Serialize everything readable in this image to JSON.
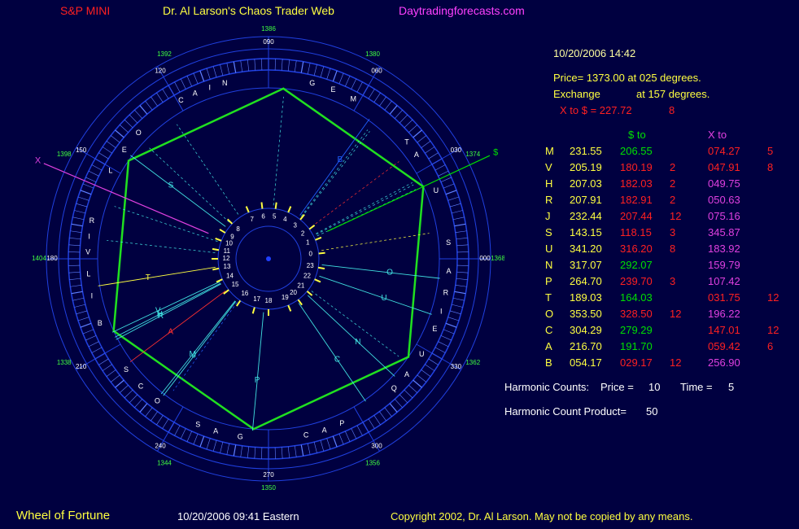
{
  "header": {
    "instrument": "S&P MINI",
    "title": "Dr. Al Larson's Chaos Trader Web",
    "site": "Daytradingforecasts.com"
  },
  "info": {
    "datetime": "10/20/2006 14:42",
    "price_line": "Price= 1373.00 at 025 degrees.",
    "exchange_label": "Exchange",
    "exchange_value": "at 157 degrees.",
    "xto_line": "X to $  = 227.72",
    "xto_count": "8"
  },
  "table": {
    "headers": {
      "dollar_to": "$ to",
      "x_to": "X to"
    },
    "rows": [
      {
        "sym": "M",
        "pos": "231.55",
        "d": "206.55",
        "dc": "",
        "x": "074.27",
        "xc": "5",
        "dcolor": "#00e000",
        "xcolor": "#ff2020"
      },
      {
        "sym": "V",
        "pos": "205.19",
        "d": "180.19",
        "dc": "2",
        "x": "047.91",
        "xc": "8",
        "dcolor": "#ff2020",
        "xcolor": "#ff2020"
      },
      {
        "sym": "H",
        "pos": "207.03",
        "d": "182.03",
        "dc": "2",
        "x": "049.75",
        "xc": "",
        "dcolor": "#ff2020",
        "xcolor": "#e040e0"
      },
      {
        "sym": "R",
        "pos": "207.91",
        "d": "182.91",
        "dc": "2",
        "x": "050.63",
        "xc": "",
        "dcolor": "#ff2020",
        "xcolor": "#e040e0"
      },
      {
        "sym": "J",
        "pos": "232.44",
        "d": "207.44",
        "dc": "12",
        "x": "075.16",
        "xc": "",
        "dcolor": "#ff2020",
        "xcolor": "#e040e0"
      },
      {
        "sym": "S",
        "pos": "143.15",
        "d": "118.15",
        "dc": "3",
        "x": "345.87",
        "xc": "",
        "dcolor": "#ff2020",
        "xcolor": "#e040e0"
      },
      {
        "sym": "U",
        "pos": "341.20",
        "d": "316.20",
        "dc": "8",
        "x": "183.92",
        "xc": "",
        "dcolor": "#ff2020",
        "xcolor": "#e040e0"
      },
      {
        "sym": "N",
        "pos": "317.07",
        "d": "292.07",
        "dc": "",
        "x": "159.79",
        "xc": "",
        "dcolor": "#00e000",
        "xcolor": "#e040e0"
      },
      {
        "sym": "P",
        "pos": "264.70",
        "d": "239.70",
        "dc": "3",
        "x": "107.42",
        "xc": "",
        "dcolor": "#ff2020",
        "xcolor": "#e040e0"
      },
      {
        "sym": "T",
        "pos": "189.03",
        "d": "164.03",
        "dc": "",
        "x": "031.75",
        "xc": "12",
        "dcolor": "#00e000",
        "xcolor": "#ff2020"
      },
      {
        "sym": "O",
        "pos": "353.50",
        "d": "328.50",
        "dc": "12",
        "x": "196.22",
        "xc": "",
        "dcolor": "#ff2020",
        "xcolor": "#e040e0"
      },
      {
        "sym": "C",
        "pos": "304.29",
        "d": "279.29",
        "dc": "",
        "x": "147.01",
        "xc": "12",
        "dcolor": "#00e000",
        "xcolor": "#ff2020"
      },
      {
        "sym": "A",
        "pos": "216.70",
        "d": "191.70",
        "dc": "",
        "x": "059.42",
        "xc": "6",
        "dcolor": "#00e000",
        "xcolor": "#ff2020"
      },
      {
        "sym": "B",
        "pos": "054.17",
        "d": "029.17",
        "dc": "12",
        "x": "256.90",
        "xc": "",
        "dcolor": "#ff2020",
        "xcolor": "#e040e0"
      }
    ]
  },
  "harmonics": {
    "label": "Harmonic Counts:",
    "price_label": "Price =",
    "price_value": "10",
    "time_label": "Time =",
    "time_value": "5",
    "product_label": "Harmonic Count Product=",
    "product_value": "50"
  },
  "footer": {
    "app_name": "Wheel of Fortune",
    "timestamp": "10/20/2006 09:41 Eastern",
    "copyright": "Copyright 2002, Dr. Al Larson. May not be copied by any means."
  },
  "wheel": {
    "degree_labels": [
      {
        "text": "000",
        "deg": 0
      },
      {
        "text": "030",
        "deg": 30
      },
      {
        "text": "060",
        "deg": 60
      },
      {
        "text": "090",
        "deg": 90
      },
      {
        "text": "120",
        "deg": 120
      },
      {
        "text": "150",
        "deg": 150
      },
      {
        "text": "180",
        "deg": 180
      },
      {
        "text": "210",
        "deg": 210
      },
      {
        "text": "240",
        "deg": 240
      },
      {
        "text": "270",
        "deg": 270
      },
      {
        "text": "300",
        "deg": 300
      },
      {
        "text": "330",
        "deg": 330
      }
    ],
    "price_labels": [
      {
        "text": "1368",
        "deg": 0
      },
      {
        "text": "1374",
        "deg": 27
      },
      {
        "text": "1380",
        "deg": 63
      },
      {
        "text": "1386",
        "deg": 90
      },
      {
        "text": "1392",
        "deg": 117
      },
      {
        "text": "1398",
        "deg": 153
      },
      {
        "text": "1404",
        "deg": 180
      },
      {
        "text": "1338",
        "deg": 207
      },
      {
        "text": "1344",
        "deg": 243
      },
      {
        "text": "1350",
        "deg": 270
      },
      {
        "text": "1356",
        "deg": 297
      },
      {
        "text": "1362",
        "deg": 333
      }
    ],
    "hour_labels": [
      {
        "text": "0",
        "deg": 6
      },
      {
        "text": "1",
        "deg": 22
      },
      {
        "text": "2",
        "deg": 36
      },
      {
        "text": "3",
        "deg": 51
      },
      {
        "text": "4",
        "deg": 67
      },
      {
        "text": "5",
        "deg": 82
      },
      {
        "text": "6",
        "deg": 97
      },
      {
        "text": "7",
        "deg": 113
      },
      {
        "text": "8",
        "deg": 136
      },
      {
        "text": "9",
        "deg": 149
      },
      {
        "text": "10",
        "deg": 159
      },
      {
        "text": "11",
        "deg": 170
      },
      {
        "text": "12",
        "deg": 180
      },
      {
        "text": "13",
        "deg": 191
      },
      {
        "text": "14",
        "deg": 204
      },
      {
        "text": "15",
        "deg": 218
      },
      {
        "text": "16",
        "deg": 236
      },
      {
        "text": "17",
        "deg": 254
      },
      {
        "text": "18",
        "deg": 270
      },
      {
        "text": "19",
        "deg": 293
      },
      {
        "text": "20",
        "deg": 306
      },
      {
        "text": "21",
        "deg": 320
      },
      {
        "text": "22",
        "deg": 336
      },
      {
        "text": "23",
        "deg": 350
      }
    ],
    "outer_letters": [
      {
        "text": "A",
        "deg": 356
      },
      {
        "text": "R",
        "deg": 349
      },
      {
        "text": "I",
        "deg": 343
      },
      {
        "text": "E",
        "deg": 337
      },
      {
        "text": "S",
        "deg": 5
      },
      {
        "text": "U",
        "deg": 22
      },
      {
        "text": "A",
        "deg": 35
      },
      {
        "text": "T",
        "deg": 40
      },
      {
        "text": "M",
        "deg": 62
      },
      {
        "text": "E",
        "deg": 69
      },
      {
        "text": "G",
        "deg": 76
      },
      {
        "text": "N",
        "deg": 104
      },
      {
        "text": "I",
        "deg": 109
      },
      {
        "text": "A",
        "deg": 114
      },
      {
        "text": "C",
        "deg": 119
      },
      {
        "text": "O",
        "deg": 136
      },
      {
        "text": "E",
        "deg": 143
      },
      {
        "text": "L",
        "deg": 151
      },
      {
        "text": "R",
        "deg": 168
      },
      {
        "text": "I",
        "deg": 173
      },
      {
        "text": "V",
        "deg": 178
      },
      {
        "text": "L",
        "deg": 185
      },
      {
        "text": "I",
        "deg": 192
      },
      {
        "text": "B",
        "deg": 201
      },
      {
        "text": "S",
        "deg": 218
      },
      {
        "text": "C",
        "deg": 225
      },
      {
        "text": "O",
        "deg": 232
      },
      {
        "text": "S",
        "deg": 247
      },
      {
        "text": "A",
        "deg": 253
      },
      {
        "text": "G",
        "deg": 261
      },
      {
        "text": "C",
        "deg": 282
      },
      {
        "text": "A",
        "deg": 288
      },
      {
        "text": "P",
        "deg": 294
      },
      {
        "text": "Q",
        "deg": 314
      },
      {
        "text": "A",
        "deg": 320
      },
      {
        "text": "U",
        "deg": 328
      }
    ],
    "planets": [
      {
        "text": "M",
        "deg": 231.55,
        "color": "#40e0e0"
      },
      {
        "text": "V",
        "deg": 205.19,
        "color": "#40e0e0"
      },
      {
        "text": "H",
        "deg": 207.03,
        "color": "#40e0e0"
      },
      {
        "text": "R",
        "deg": 207.91,
        "color": "#40e0e0"
      },
      {
        "text": "J",
        "deg": 232.44,
        "color": "#40e0e0"
      },
      {
        "text": "S",
        "deg": 143.15,
        "color": "#40e0e0"
      },
      {
        "text": "U",
        "deg": 341.2,
        "color": "#40e0e0"
      },
      {
        "text": "N",
        "deg": 317.07,
        "color": "#40e0e0"
      },
      {
        "text": "P",
        "deg": 264.7,
        "color": "#40e0e0"
      },
      {
        "text": "T",
        "deg": 189.03,
        "color": "#ffff40"
      },
      {
        "text": "O",
        "deg": 353.5,
        "color": "#40e0e0"
      },
      {
        "text": "C",
        "deg": 304.29,
        "color": "#40e0e0"
      },
      {
        "text": "A",
        "deg": 216.7,
        "color": "#ff3030"
      },
      {
        "text": "B",
        "deg": 54.17,
        "color": "#2060ff"
      }
    ],
    "markers": [
      {
        "text": "$",
        "deg": 25,
        "color": "#00e000"
      },
      {
        "text": "X",
        "deg": 157,
        "color": "#e040e0"
      }
    ],
    "hexagon_start_deg": 25,
    "colors": {
      "background": "#000040",
      "ring": "#2040e0",
      "hexagon": "#20e020",
      "degree_label": "#ffffff",
      "price_label": "#40ff40"
    }
  }
}
